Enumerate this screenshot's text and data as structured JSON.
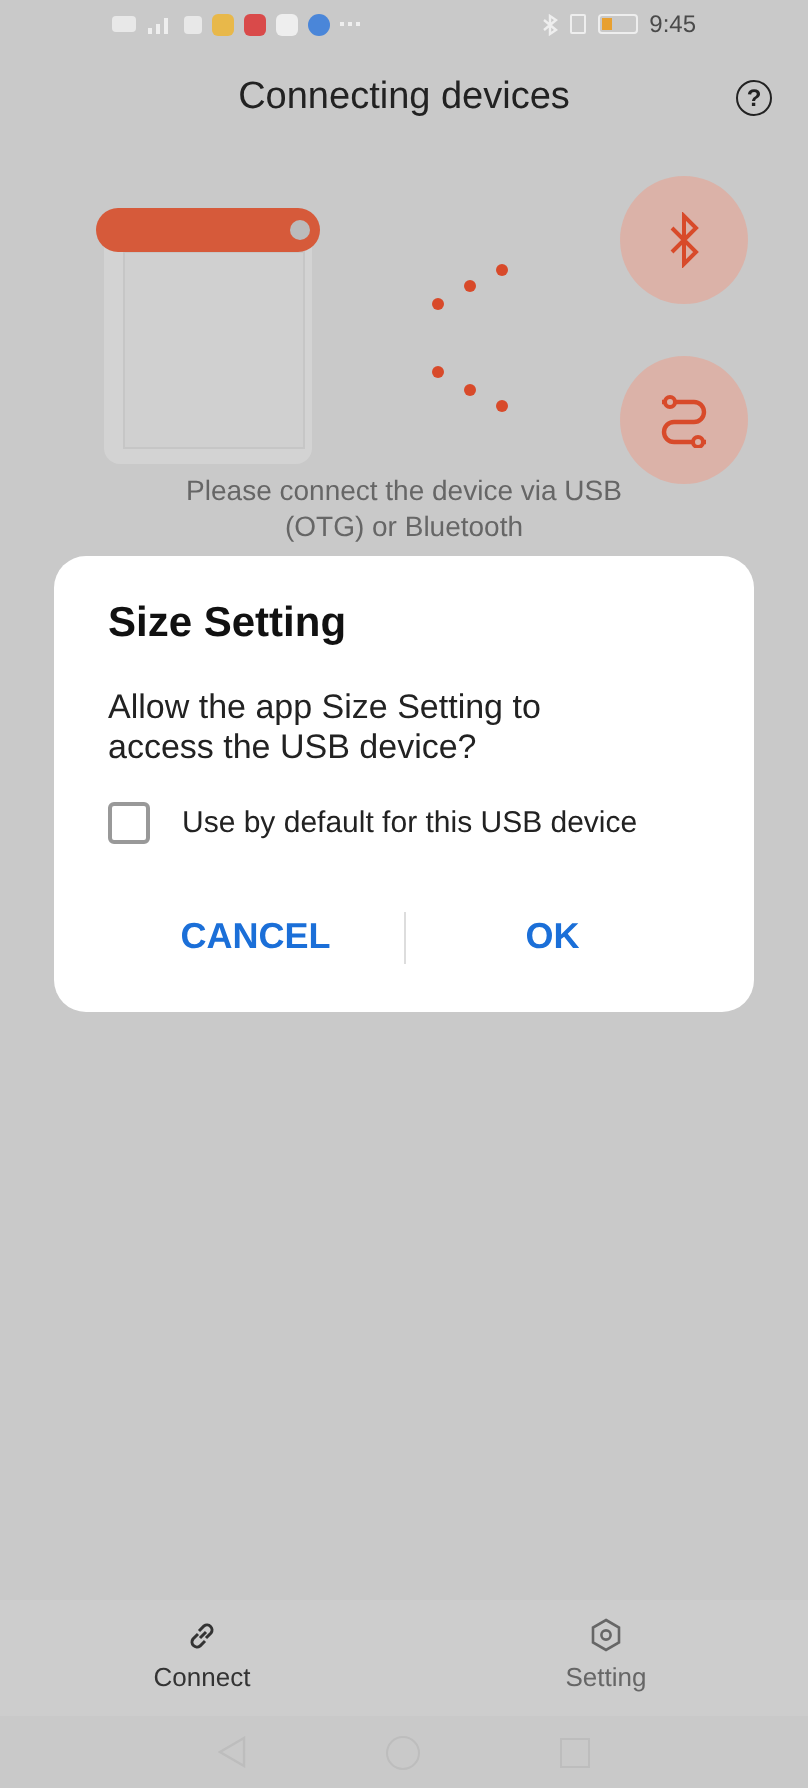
{
  "status_bar": {
    "time": "9:45"
  },
  "header": {
    "title": "Connecting devices",
    "help_icon": "?"
  },
  "hint": "Please connect the device via USB (OTG) or Bluetooth",
  "dialog": {
    "title": "Size Setting",
    "message": "Allow the app Size Setting to access the USB device?",
    "checkbox": {
      "label": "Use by default for this USB device",
      "checked": false
    },
    "buttons": [
      "CANCEL",
      "OK"
    ]
  },
  "bottom_nav": [
    {
      "label": "Connect",
      "kind": "link",
      "selected": true
    },
    {
      "label": "Setting",
      "kind": "gear",
      "selected": false
    }
  ]
}
